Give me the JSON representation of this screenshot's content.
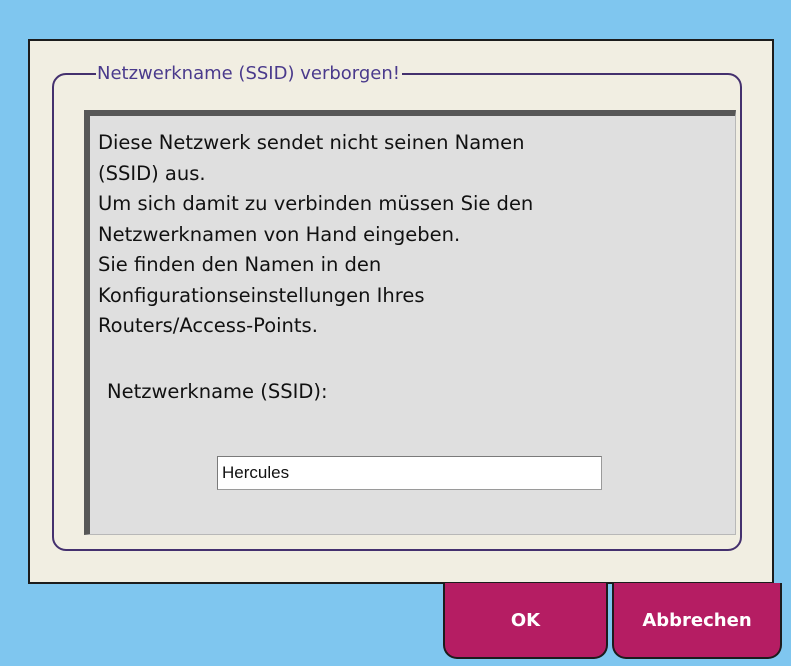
{
  "dialog": {
    "title": "Netzwerkname (SSID) verborgen!",
    "message_lines": [
      "Diese Netzwerk sendet nicht seinen Namen",
      "(SSID) aus.",
      "Um sich damit zu verbinden müssen Sie den",
      "Netzwerknamen von Hand eingeben.",
      "Sie finden den Namen in den",
      "Konfigurationseinstellungen Ihres",
      "Routers/Access-Points."
    ],
    "ssid_label": "Netzwerkname (SSID):",
    "ssid_value": "Hercules"
  },
  "buttons": {
    "ok_label": "OK",
    "cancel_label": "Abbrechen"
  },
  "colors": {
    "background": "#7fc6ef",
    "dialog_bg": "#f1eee2",
    "group_border": "#44306e",
    "title_text": "#4a3a8c",
    "panel_bg": "#dfdfdf",
    "button_bg": "#b51d63"
  }
}
